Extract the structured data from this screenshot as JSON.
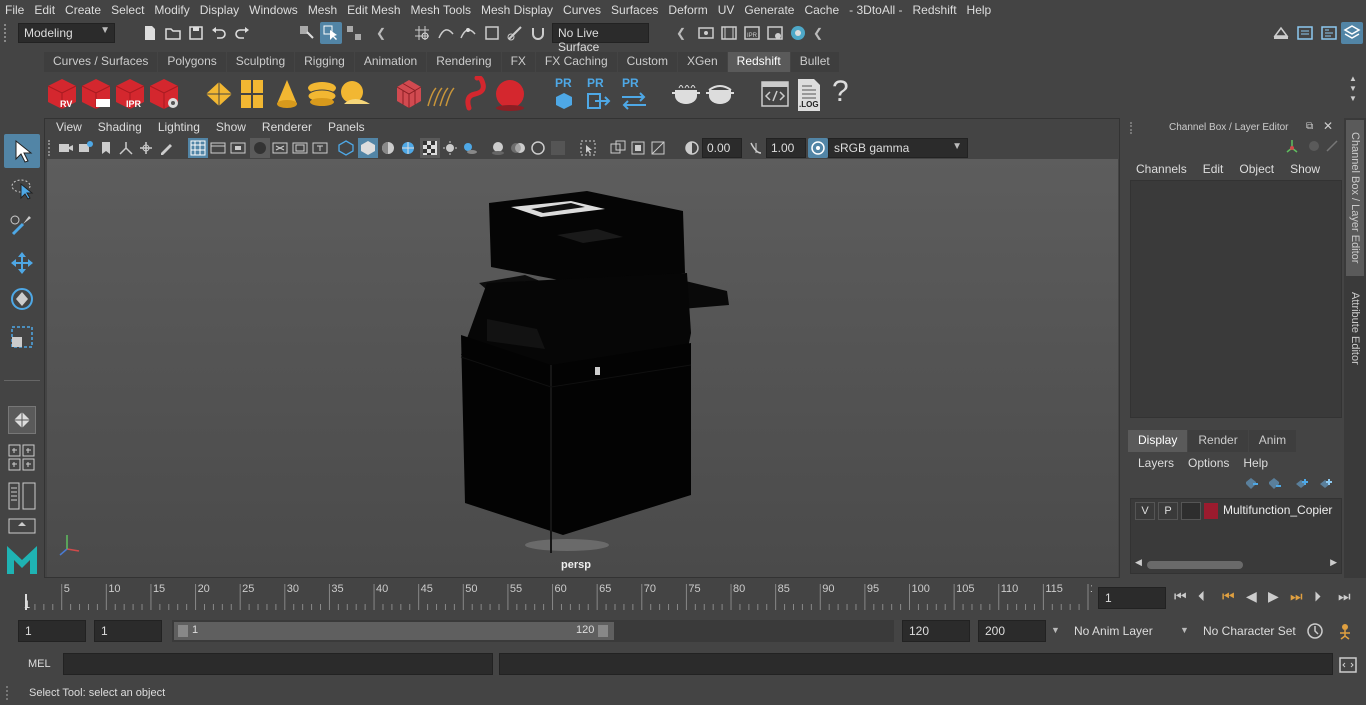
{
  "menubar": [
    "File",
    "Edit",
    "Create",
    "Select",
    "Modify",
    "Display",
    "Windows",
    "Mesh",
    "Edit Mesh",
    "Mesh Tools",
    "Mesh Display",
    "Curves",
    "Surfaces",
    "Deform",
    "UV",
    "Generate",
    "Cache",
    "- 3DtoAll -",
    "Redshift",
    "Help"
  ],
  "statusline": {
    "mode": "Modeling",
    "live_surface": "No Live Surface"
  },
  "shelf_tabs": [
    "Curves / Surfaces",
    "Polygons",
    "Sculpting",
    "Rigging",
    "Animation",
    "Rendering",
    "FX",
    "FX Caching",
    "Custom",
    "XGen",
    "Redshift",
    "Bullet"
  ],
  "shelf_active": "Redshift",
  "shelf_icons": {
    "rv": "RV",
    "ipr": "IPR",
    "pr": "PR",
    "log": ".LOG",
    "help": "?"
  },
  "viewport": {
    "menu": [
      "View",
      "Shading",
      "Lighting",
      "Show",
      "Renderer",
      "Panels"
    ],
    "exposure": "0.00",
    "gamma": "1.00",
    "colorspace": "sRGB gamma",
    "camera_label": "persp"
  },
  "channel_box": {
    "title": "Channel Box / Layer Editor",
    "menu": [
      "Channels",
      "Edit",
      "Object",
      "Show"
    ]
  },
  "layer_editor": {
    "tabs": [
      "Display",
      "Render",
      "Anim"
    ],
    "active_tab": "Display",
    "menu": [
      "Layers",
      "Options",
      "Help"
    ],
    "layer": {
      "v": "V",
      "p": "P",
      "name": "Multifunction_Copier",
      "color": "#9b1b2e"
    }
  },
  "side_tabs": [
    "Channel Box / Layer Editor",
    "Attribute Editor"
  ],
  "timeline": {
    "ticks": [
      "5",
      "10",
      "15",
      "20",
      "25",
      "30",
      "35",
      "40",
      "45",
      "50",
      "55",
      "60",
      "65",
      "70",
      "75",
      "80",
      "85",
      "90",
      "95",
      "100",
      "105",
      "110",
      "115",
      "12"
    ],
    "start_label": "1",
    "current_frame": "1"
  },
  "range": {
    "start": "1",
    "playback_start": "1",
    "slider_start": "1",
    "slider_end": "120",
    "playback_end": "120",
    "end": "200",
    "anim_layer": "No Anim Layer",
    "character_set": "No Character Set"
  },
  "mel": {
    "label": "MEL"
  },
  "helpline": "Select Tool: select an object",
  "colors": {
    "accent": "#5285a6",
    "panel": "#444444",
    "field": "#2b2b2b",
    "redshift_red": "#d4272e",
    "shelf_yellow": "#f2b732"
  }
}
